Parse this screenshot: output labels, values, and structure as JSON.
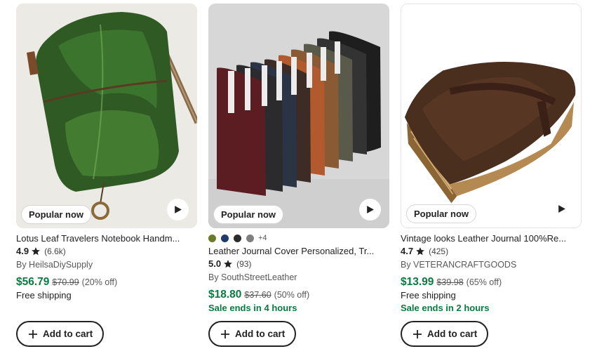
{
  "listings": [
    {
      "badge": "Popular now",
      "title": "Lotus Leaf Travelers Notebook Handm...",
      "rating": "4.9",
      "reviews": "(6.6k)",
      "shop": "By HeilsaDiySupply",
      "price": "$56.79",
      "original_price": "$70.99",
      "discount": "(20% off)",
      "shipping": "Free shipping",
      "cart_label": "Add to cart"
    },
    {
      "badge": "Popular now",
      "swatches": [
        "#6b7a2a",
        "#1f3a6b",
        "#2b2b2b",
        "#7f7f7f"
      ],
      "more_swatches": "+4",
      "title": "Leather Journal Cover Personalized, Tr...",
      "rating": "5.0",
      "reviews": "(93)",
      "shop": "By SouthStreetLeather",
      "price": "$18.80",
      "original_price": "$37.60",
      "discount": "(50% off)",
      "sale": "Sale ends in 4 hours",
      "cart_label": "Add to cart"
    },
    {
      "badge": "Popular now",
      "title": "Vintage looks Leather Journal 100%Re...",
      "rating": "4.7",
      "reviews": "(425)",
      "shop": "By VETERANCRAFTGOODS",
      "price": "$13.99",
      "original_price": "$39.98",
      "discount": "(65% off)",
      "shipping": "Free shipping",
      "sale": "Sale ends in 2 hours",
      "cart_label": "Add to cart"
    }
  ],
  "icons": {
    "play": "play-icon",
    "star": "star-icon",
    "plus": "plus-icon"
  },
  "colors": {
    "price_green": "#0b7a3e",
    "text": "#222222",
    "muted": "#595959"
  }
}
